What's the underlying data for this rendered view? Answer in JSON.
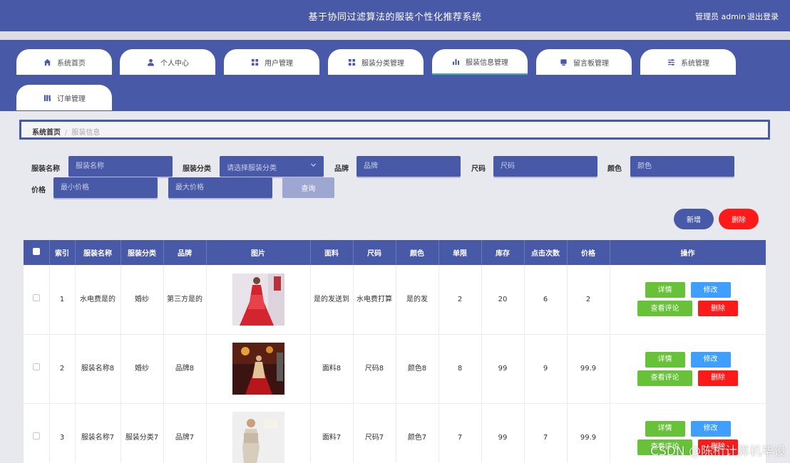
{
  "header": {
    "title": "基于协同过滤算法的服装个性化推荐系统",
    "user": "管理员 admin",
    "logout": "退出登录"
  },
  "nav": {
    "tabs": [
      {
        "label": "系统首页",
        "icon": "home-icon"
      },
      {
        "label": "个人中心",
        "icon": "user-icon"
      },
      {
        "label": "用户管理",
        "icon": "grid-icon"
      },
      {
        "label": "服装分类管理",
        "icon": "grid-icon"
      },
      {
        "label": "服装信息管理",
        "icon": "bar-chart-icon",
        "active": true
      },
      {
        "label": "留言板管理",
        "icon": "message-icon"
      },
      {
        "label": "系统管理",
        "icon": "sliders-icon"
      },
      {
        "label": "订单管理",
        "icon": "book-icon"
      }
    ]
  },
  "breadcrumb": {
    "home": "系统首页",
    "current": "服装信息"
  },
  "search": {
    "name_label": "服装名称",
    "name_placeholder": "服装名称",
    "category_label": "服装分类",
    "category_placeholder": "请选择服装分类",
    "brand_label": "品牌",
    "brand_placeholder": "品牌",
    "size_label": "尺码",
    "size_placeholder": "尺码",
    "color_label": "颜色",
    "color_placeholder": "颜色",
    "price_label": "价格",
    "min_price_placeholder": "最小价格",
    "max_price_placeholder": "最大价格",
    "query": "查询"
  },
  "actions": {
    "add": "新增",
    "delete": "删除"
  },
  "table": {
    "headers": [
      "索引",
      "服装名称",
      "服装分类",
      "品牌",
      "图片",
      "面料",
      "尺码",
      "颜色",
      "单限",
      "库存",
      "点击次数",
      "价格",
      "操作"
    ],
    "rows": [
      {
        "index": "1",
        "name": "水电费是的",
        "category": "婚纱",
        "brand": "第三方是的",
        "fabric": "是的发送到",
        "size": "水电费打算",
        "color": "是的发",
        "limit": "2",
        "stock": "20",
        "clicks": "6",
        "price": "2"
      },
      {
        "index": "2",
        "name": "服装名称8",
        "category": "婚纱",
        "brand": "品牌8",
        "fabric": "面料8",
        "size": "尺码8",
        "color": "颜色8",
        "limit": "8",
        "stock": "99",
        "clicks": "9",
        "price": "99.9"
      },
      {
        "index": "3",
        "name": "服装名称7",
        "category": "服装分类7",
        "brand": "品牌7",
        "fabric": "面料7",
        "size": "尺码7",
        "color": "颜色7",
        "limit": "7",
        "stock": "99",
        "clicks": "7",
        "price": "99.9"
      }
    ],
    "op_labels": {
      "detail": "详情",
      "edit": "修改",
      "review": "查看评论",
      "delete": "删除"
    }
  },
  "watermark": "CSDN @陈桁计算机毕设",
  "colors": {
    "primary": "#4859a8",
    "danger": "#ff1a1a",
    "success": "#67c23a",
    "info": "#409eff"
  }
}
